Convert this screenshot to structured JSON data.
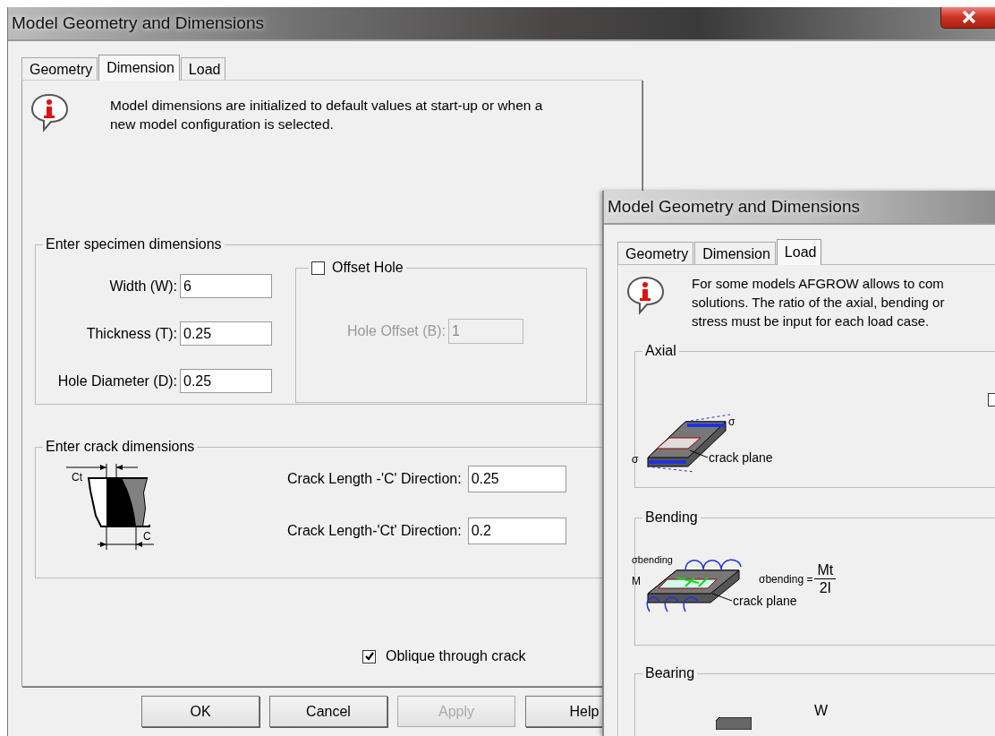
{
  "main_window": {
    "title": "Model Geometry and Dimensions",
    "tabs": [
      {
        "label": "Geometry",
        "selected": false
      },
      {
        "label": "Dimension",
        "selected": true
      },
      {
        "label": "Load",
        "selected": false
      }
    ],
    "info_lines": [
      "Model dimensions are initialized to default values at start-up or when a",
      "new model  configuration  is  selected."
    ],
    "specimen_group": {
      "title": "Enter  specimen dimensions",
      "fields": [
        {
          "label": "Width (W):",
          "value": "6"
        },
        {
          "label": "Thickness (T):",
          "value": "0.25"
        },
        {
          "label": "Hole Diameter (D):",
          "value": "0.25"
        }
      ],
      "offset_hole": {
        "label": "Offset Hole",
        "checked": false,
        "field": {
          "label": "Hole Offset (B):",
          "value": "1",
          "disabled": true
        }
      }
    },
    "crack_group": {
      "title": "Enter crack dimensions",
      "diagram_labels": [
        "Ct",
        "C"
      ],
      "fields": [
        {
          "label": "Crack Length -'C' Direction:",
          "value": "0.25"
        },
        {
          "label": "Crack Length-'Ct' Direction:",
          "value": "0.2"
        }
      ]
    },
    "oblique": {
      "label": "Oblique through crack",
      "checked": true
    },
    "buttons": [
      {
        "label": "OK",
        "disabled": false
      },
      {
        "label": "Cancel",
        "disabled": false
      },
      {
        "label": "Apply",
        "disabled": true
      },
      {
        "label": "Help",
        "disabled": false
      }
    ]
  },
  "load_window": {
    "title": "Model Geometry and Dimensions",
    "tabs": [
      {
        "label": "Geometry",
        "selected": false
      },
      {
        "label": "Dimension",
        "selected": false
      },
      {
        "label": "Load",
        "selected": true
      }
    ],
    "info_lines": [
      "For some models AFGROW allows to com",
      "solutions. The ratio of the axial, bending or",
      "stress must be input for each load case."
    ],
    "groups": [
      {
        "kind": "axial",
        "title": "Axial",
        "labels": [
          "σ",
          "σ",
          "crack plane"
        ],
        "checked": false
      },
      {
        "kind": "bending",
        "title": "Bending",
        "labels": [
          "σbending",
          "M",
          "crack plane"
        ],
        "formula": {
          "lhs": "σbending =",
          "numerator": "Mt",
          "denominator": "2I"
        }
      },
      {
        "kind": "bearing",
        "title": "Bearing",
        "labels": [
          "W"
        ]
      }
    ]
  }
}
